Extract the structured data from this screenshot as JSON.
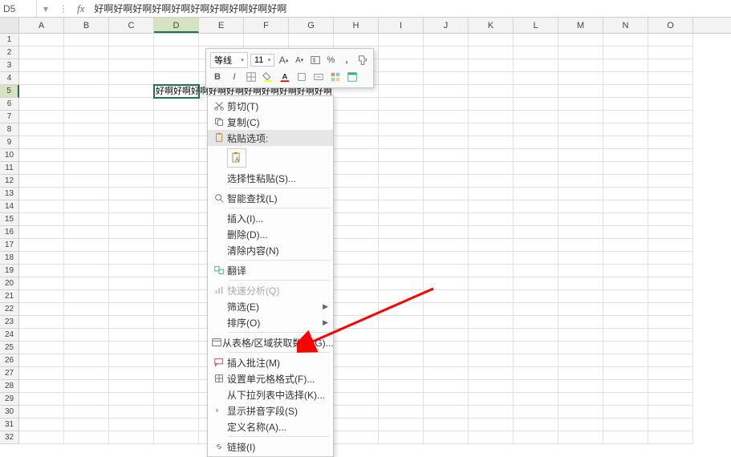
{
  "formula_bar": {
    "cell_ref": "D5",
    "formula_text": "好啊好啊好啊好啊好啊好啊好啊好啊好啊好啊"
  },
  "columns": [
    "A",
    "B",
    "C",
    "D",
    "E",
    "F",
    "G",
    "H",
    "I",
    "J",
    "K",
    "L",
    "M",
    "N",
    "O"
  ],
  "rows": [
    "1",
    "2",
    "3",
    "4",
    "5",
    "6",
    "7",
    "8",
    "9",
    "10",
    "11",
    "12",
    "13",
    "14",
    "15",
    "16",
    "17",
    "18",
    "19",
    "20",
    "21",
    "22",
    "23",
    "24",
    "25",
    "26",
    "27",
    "28",
    "29",
    "30",
    "31",
    "32"
  ],
  "active": {
    "row": 5,
    "col": "D",
    "value": "好啊好啊好啊好啊好啊好啊好啊好啊好啊好啊"
  },
  "mini_toolbar": {
    "font_name": "等线",
    "font_size": "11",
    "increase_font": "A",
    "decrease_font": "A",
    "bold": "B",
    "italic": "I"
  },
  "context_menu": {
    "cut": "剪切(T)",
    "copy": "复制(C)",
    "paste_options_label": "粘贴选项:",
    "paste_special": "选择性粘贴(S)...",
    "smart_lookup": "智能查找(L)",
    "insert": "插入(I)...",
    "delete": "删除(D)...",
    "clear_contents": "清除内容(N)",
    "translate": "翻译",
    "quick_analysis": "快速分析(Q)",
    "filter": "筛选(E)",
    "sort": "排序(O)",
    "get_data_from_table": "从表格/区域获取数据(G)...",
    "insert_comment": "插入批注(M)",
    "format_cells": "设置单元格格式(F)...",
    "pick_from_dropdown": "从下拉列表中选择(K)...",
    "show_phonetic": "显示拼音字段(S)",
    "define_name": "定义名称(A)...",
    "hyperlink": "链接(I)"
  }
}
